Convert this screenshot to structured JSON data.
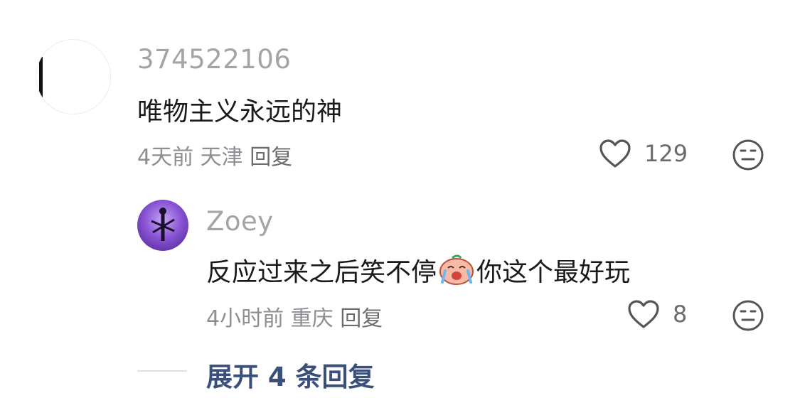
{
  "comment1": {
    "username": "374522106",
    "text": "唯物主义永远的神",
    "time": "4天前",
    "location": "天津",
    "reply_label": "回复",
    "likes": "129"
  },
  "comment2": {
    "username": "Zoey",
    "text_before": "反应过来之后笑不停",
    "emoji": "crying-laughing-emoji",
    "text_after": "你这个最好玩",
    "time": "4小时前",
    "location": "重庆",
    "reply_label": "回复",
    "likes": "8"
  },
  "expand_replies_label": "展开 4 条回复"
}
